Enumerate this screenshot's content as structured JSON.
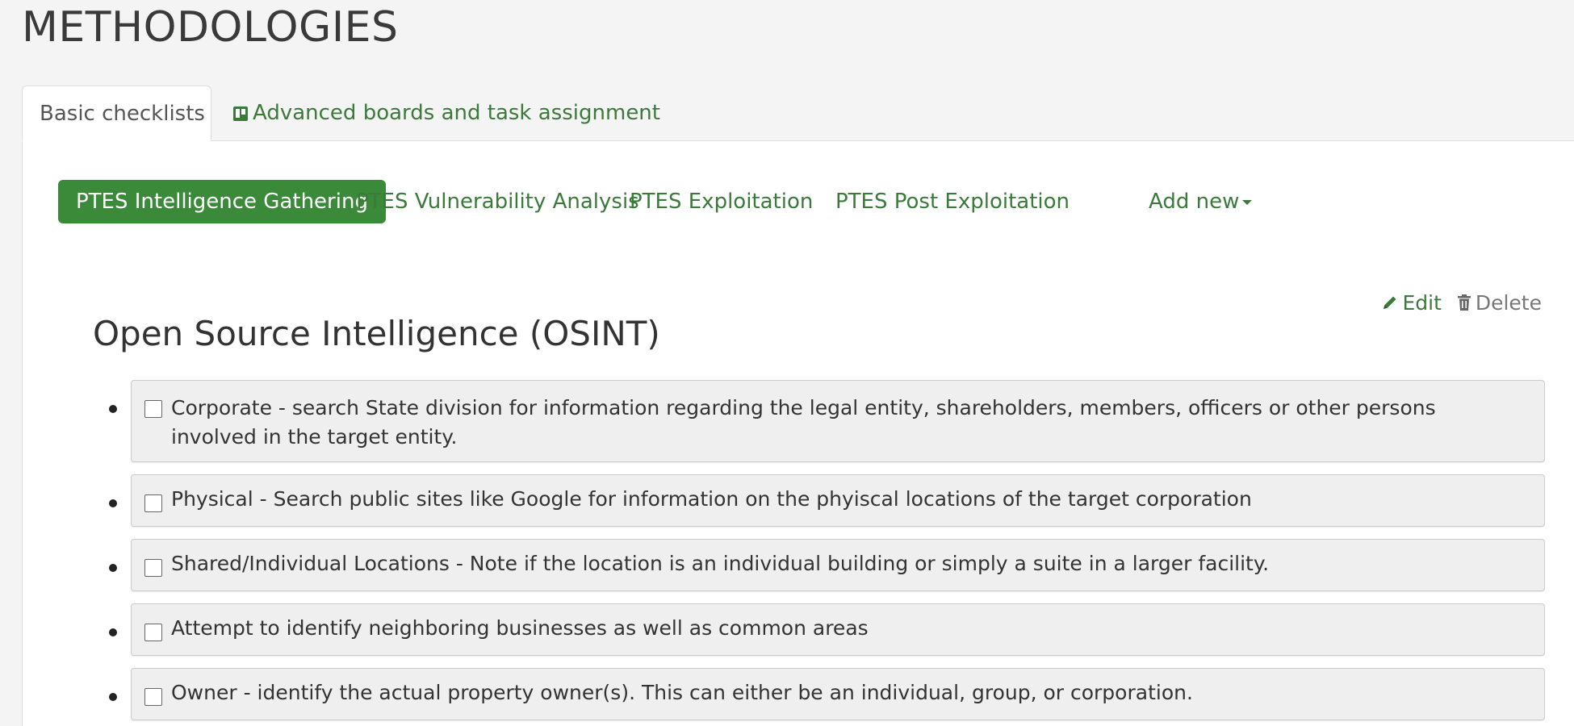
{
  "page": {
    "title": "METHODOLOGIES"
  },
  "tabs": {
    "basic_checklists": "Basic checklists",
    "advanced_boards": "Advanced boards and task assignment"
  },
  "pills": [
    "PTES Intelligence Gathering",
    "PTES Vulnerability Analysis",
    "PTES Exploitation",
    "PTES Post Exploitation",
    "Add new"
  ],
  "actions": {
    "edit": "Edit",
    "delete": "Delete"
  },
  "section": {
    "title": "Open Source Intelligence (OSINT)"
  },
  "checklist": [
    "Corporate - search State division for information regarding the legal entity, shareholders, members, officers or other persons involved in the target entity.",
    "Physical - Search public sites like Google for information on the phyiscal locations of the target corporation",
    "Shared/Individual Locations - Note if the location is an individual building or simply a suite in a larger facility.",
    "Attempt to identify neighboring businesses as well as common areas",
    "Owner - identify the actual property owner(s). This can either be an individual, group, or corporation."
  ],
  "colors": {
    "accent_green": "#3b7a3b",
    "active_pill": "#3a8a3a",
    "background": "#f4f4f4"
  },
  "icons": {
    "advanced_tab": "board-icon",
    "edit": "pencil-icon",
    "delete": "trash-icon",
    "add_new": "caret-down-icon"
  }
}
